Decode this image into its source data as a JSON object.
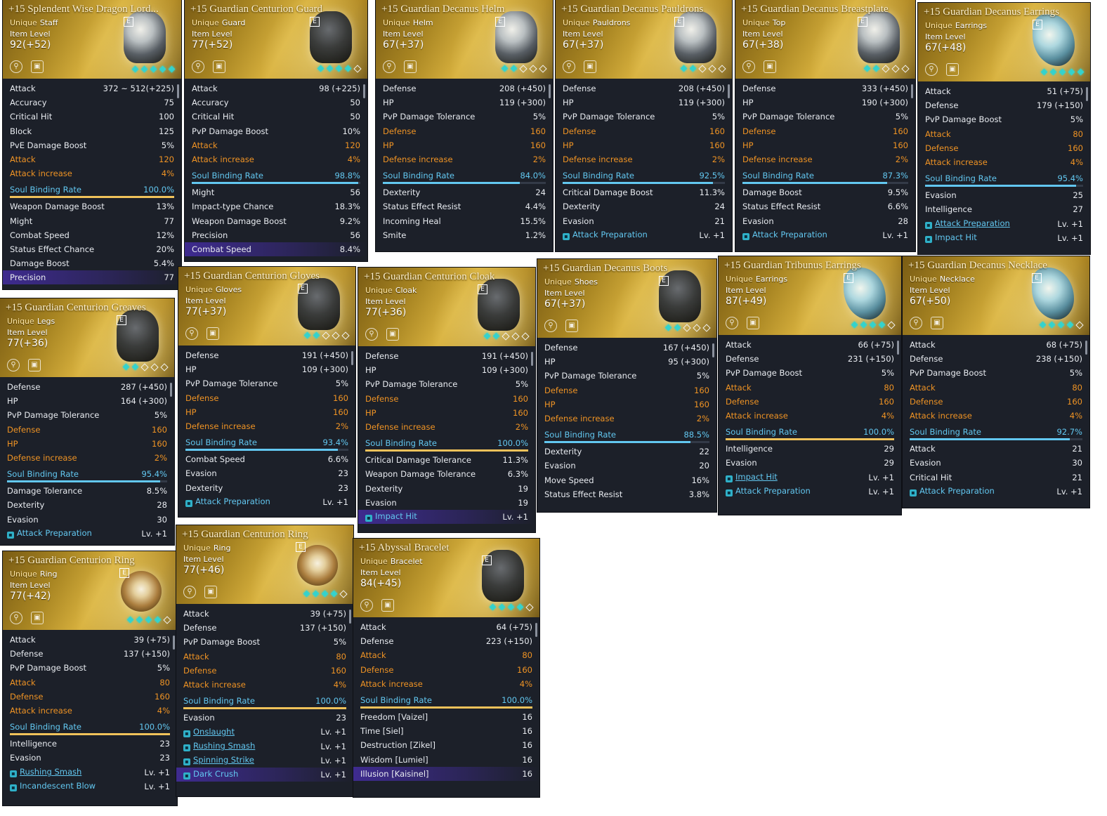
{
  "labels": {
    "item_level": "Item Level",
    "soul_binding_rate": "Soul Binding Rate",
    "badge": "E"
  },
  "items": [
    {
      "name": "+15 Splendent Wise Dragon Lord...",
      "rarity": "Unique",
      "type": "Staff",
      "level": "92(+52)",
      "art": "staff-art",
      "enhance": [
        true,
        true,
        true,
        true,
        true
      ],
      "base": [
        [
          "Attack",
          "372 ~ 512(+225)"
        ],
        [
          "Accuracy",
          "75"
        ],
        [
          "Critical Hit",
          "100"
        ],
        [
          "Block",
          "125"
        ],
        [
          "PvE Damage Boost",
          "5%"
        ]
      ],
      "bonus": [
        [
          "Attack",
          "120"
        ],
        [
          "Attack increase",
          "4%"
        ]
      ],
      "soul_rate": "100.0%",
      "soul_pct": 100,
      "soul": [
        [
          "Weapon Damage Boost",
          "13%"
        ],
        [
          "Might",
          "77"
        ],
        [
          "Combat Speed",
          "12%"
        ],
        [
          "Status Effect Chance",
          "20%"
        ],
        [
          "Damage Boost",
          "5.4%"
        ],
        [
          "Precision",
          "77"
        ]
      ],
      "highlight": 5
    },
    {
      "name": "+15 Guardian Centurion Guard",
      "rarity": "Unique",
      "type": "Guard",
      "level": "77(+52)",
      "art": "guard-art",
      "enhance": [
        true,
        true,
        true,
        true,
        false
      ],
      "base": [
        [
          "Attack",
          "98 (+225)"
        ],
        [
          "Accuracy",
          "50"
        ],
        [
          "Critical Hit",
          "50"
        ],
        [
          "PvP Damage Boost",
          "10%"
        ]
      ],
      "bonus": [
        [
          "Attack",
          "120"
        ],
        [
          "Attack increase",
          "4%"
        ]
      ],
      "soul_rate": "98.8%",
      "soul_pct": 98.8,
      "soul": [
        [
          "Might",
          "56"
        ],
        [
          "Impact-type Chance",
          "18.3%"
        ],
        [
          "Weapon Damage Boost",
          "9.2%"
        ],
        [
          "Precision",
          "56"
        ],
        [
          "Combat Speed",
          "8.4%"
        ]
      ],
      "highlight": 4
    },
    {
      "name": "+15 Guardian Decanus Helm",
      "rarity": "Unique",
      "type": "Helm",
      "level": "67(+37)",
      "art": "helm-art",
      "enhance": [
        true,
        true,
        false,
        false,
        false
      ],
      "base": [
        [
          "Defense",
          "208 (+450)"
        ],
        [
          "HP",
          "119 (+300)"
        ],
        [
          "PvP Damage Tolerance",
          "5%"
        ]
      ],
      "bonus": [
        [
          "Defense",
          "160"
        ],
        [
          "HP",
          "160"
        ],
        [
          "Defense increase",
          "2%"
        ]
      ],
      "soul_rate": "84.0%",
      "soul_pct": 84,
      "soul": [
        [
          "Dexterity",
          "24"
        ],
        [
          "Status Effect Resist",
          "4.4%"
        ],
        [
          "Incoming Heal",
          "15.5%"
        ],
        [
          "Smite",
          "1.2%"
        ]
      ]
    },
    {
      "name": "+15 Guardian Decanus Pauldrons",
      "rarity": "Unique",
      "type": "Pauldrons",
      "level": "67(+37)",
      "art": "pauldrons-art",
      "enhance": [
        true,
        true,
        false,
        false,
        false
      ],
      "base": [
        [
          "Defense",
          "208 (+450)"
        ],
        [
          "HP",
          "119 (+300)"
        ],
        [
          "PvP Damage Tolerance",
          "5%"
        ]
      ],
      "bonus": [
        [
          "Defense",
          "160"
        ],
        [
          "HP",
          "160"
        ],
        [
          "Defense increase",
          "2%"
        ]
      ],
      "soul_rate": "92.5%",
      "soul_pct": 92.5,
      "soul": [
        [
          "Critical Damage Boost",
          "11.3%"
        ],
        [
          "Dexterity",
          "24"
        ],
        [
          "Evasion",
          "21"
        ]
      ],
      "skills": [
        [
          "Attack Preparation",
          "Lv. +1",
          false
        ]
      ]
    },
    {
      "name": "+15 Guardian Decanus Breastplate",
      "rarity": "Unique",
      "type": "Top",
      "level": "67(+38)",
      "art": "breastplate-art",
      "enhance": [
        true,
        true,
        false,
        false,
        false
      ],
      "base": [
        [
          "Defense",
          "333 (+450)"
        ],
        [
          "HP",
          "190 (+300)"
        ],
        [
          "PvP Damage Tolerance",
          "5%"
        ]
      ],
      "bonus": [
        [
          "Defense",
          "160"
        ],
        [
          "HP",
          "160"
        ],
        [
          "Defense increase",
          "2%"
        ]
      ],
      "soul_rate": "87.3%",
      "soul_pct": 87.3,
      "soul": [
        [
          "Damage Boost",
          "9.5%"
        ],
        [
          "Status Effect Resist",
          "6.6%"
        ],
        [
          "Evasion",
          "28"
        ]
      ],
      "skills": [
        [
          "Attack Preparation",
          "Lv. +1",
          false
        ]
      ]
    },
    {
      "name": "+15 Guardian Decanus Earrings",
      "rarity": "Unique",
      "type": "Earrings",
      "level": "67(+48)",
      "art": "earrings-art",
      "enhance": [
        true,
        true,
        true,
        true,
        true
      ],
      "base": [
        [
          "Attack",
          "51 (+75)"
        ],
        [
          "Defense",
          "179 (+150)"
        ],
        [
          "PvP Damage Boost",
          "5%"
        ]
      ],
      "bonus": [
        [
          "Attack",
          "80"
        ],
        [
          "Defense",
          "160"
        ],
        [
          "Attack increase",
          "4%"
        ]
      ],
      "soul_rate": "95.4%",
      "soul_pct": 95.4,
      "soul": [
        [
          "Evasion",
          "25"
        ],
        [
          "Intelligence",
          "27"
        ]
      ],
      "skills": [
        [
          "Attack Preparation",
          "Lv. +1",
          true
        ],
        [
          "Impact Hit",
          "Lv. +1",
          false
        ]
      ]
    },
    {
      "name": "+15 Guardian Centurion Greaves",
      "rarity": "Unique",
      "type": "Legs",
      "level": "77(+36)",
      "art": "greaves-art",
      "enhance": [
        true,
        true,
        false,
        false,
        false
      ],
      "base": [
        [
          "Defense",
          "287 (+450)"
        ],
        [
          "HP",
          "164 (+300)"
        ],
        [
          "PvP Damage Tolerance",
          "5%"
        ]
      ],
      "bonus": [
        [
          "Defense",
          "160"
        ],
        [
          "HP",
          "160"
        ],
        [
          "Defense increase",
          "2%"
        ]
      ],
      "soul_rate": "95.4%",
      "soul_pct": 95.4,
      "soul": [
        [
          "Damage Tolerance",
          "8.5%"
        ],
        [
          "Dexterity",
          "28"
        ],
        [
          "Evasion",
          "30"
        ]
      ],
      "skills": [
        [
          "Attack Preparation",
          "Lv. +1",
          false
        ]
      ]
    },
    {
      "name": "+15 Guardian Centurion Gloves",
      "rarity": "Unique",
      "type": "Gloves",
      "level": "77(+37)",
      "art": "gloves-art",
      "enhance": [
        true,
        true,
        false,
        false,
        false
      ],
      "base": [
        [
          "Defense",
          "191 (+450)"
        ],
        [
          "HP",
          "109 (+300)"
        ],
        [
          "PvP Damage Tolerance",
          "5%"
        ]
      ],
      "bonus": [
        [
          "Defense",
          "160"
        ],
        [
          "HP",
          "160"
        ],
        [
          "Defense increase",
          "2%"
        ]
      ],
      "soul_rate": "93.4%",
      "soul_pct": 93.4,
      "soul": [
        [
          "Combat Speed",
          "6.6%"
        ],
        [
          "Evasion",
          "23"
        ],
        [
          "Dexterity",
          "23"
        ]
      ],
      "skills": [
        [
          "Attack Preparation",
          "Lv. +1",
          false
        ]
      ]
    },
    {
      "name": "+15 Guardian Centurion Cloak",
      "rarity": "Unique",
      "type": "Cloak",
      "level": "77(+36)",
      "art": "cloak-art",
      "enhance": [
        true,
        true,
        false,
        false,
        false
      ],
      "base": [
        [
          "Defense",
          "191 (+450)"
        ],
        [
          "HP",
          "109 (+300)"
        ],
        [
          "PvP Damage Tolerance",
          "5%"
        ]
      ],
      "bonus": [
        [
          "Defense",
          "160"
        ],
        [
          "HP",
          "160"
        ],
        [
          "Defense increase",
          "2%"
        ]
      ],
      "soul_rate": "100.0%",
      "soul_pct": 100,
      "soul": [
        [
          "Critical Damage Tolerance",
          "11.3%"
        ],
        [
          "Weapon Damage Tolerance",
          "6.3%"
        ],
        [
          "Dexterity",
          "19"
        ],
        [
          "Evasion",
          "19"
        ]
      ],
      "skills": [
        [
          "Impact Hit",
          "Lv. +1",
          false
        ]
      ],
      "highlight_skill": 0
    },
    {
      "name": "+15 Guardian Decanus Boots",
      "rarity": "Unique",
      "type": "Shoes",
      "level": "67(+37)",
      "art": "boots-art",
      "enhance": [
        true,
        true,
        false,
        false,
        false
      ],
      "base": [
        [
          "Defense",
          "167 (+450)"
        ],
        [
          "HP",
          "95 (+300)"
        ],
        [
          "PvP Damage Tolerance",
          "5%"
        ]
      ],
      "bonus": [
        [
          "Defense",
          "160"
        ],
        [
          "HP",
          "160"
        ],
        [
          "Defense increase",
          "2%"
        ]
      ],
      "soul_rate": "88.5%",
      "soul_pct": 88.5,
      "soul": [
        [
          "Dexterity",
          "22"
        ],
        [
          "Evasion",
          "20"
        ],
        [
          "Move Speed",
          "16%"
        ],
        [
          "Status Effect Resist",
          "3.8%"
        ]
      ]
    },
    {
      "name": "+15 Guardian Tribunus Earrings",
      "rarity": "Unique",
      "type": "Earrings",
      "level": "87(+49)",
      "art": "tribunus-earrings-art",
      "enhance": [
        true,
        true,
        true,
        true,
        false
      ],
      "base": [
        [
          "Attack",
          "66 (+75)"
        ],
        [
          "Defense",
          "231 (+150)"
        ],
        [
          "PvP Damage Boost",
          "5%"
        ]
      ],
      "bonus": [
        [
          "Attack",
          "80"
        ],
        [
          "Defense",
          "160"
        ],
        [
          "Attack increase",
          "4%"
        ]
      ],
      "soul_rate": "100.0%",
      "soul_pct": 100,
      "soul": [
        [
          "Intelligence",
          "29"
        ],
        [
          "Evasion",
          "29"
        ]
      ],
      "skills": [
        [
          "Impact Hit",
          "Lv. +1",
          true
        ],
        [
          "Attack Preparation",
          "Lv. +1",
          false
        ]
      ]
    },
    {
      "name": "+15 Guardian Decanus Necklace",
      "rarity": "Unique",
      "type": "Necklace",
      "level": "67(+50)",
      "art": "necklace-art",
      "enhance": [
        true,
        true,
        true,
        true,
        false
      ],
      "base": [
        [
          "Attack",
          "68 (+75)"
        ],
        [
          "Defense",
          "238 (+150)"
        ],
        [
          "PvP Damage Boost",
          "5%"
        ]
      ],
      "bonus": [
        [
          "Attack",
          "80"
        ],
        [
          "Defense",
          "160"
        ],
        [
          "Attack increase",
          "4%"
        ]
      ],
      "soul_rate": "92.7%",
      "soul_pct": 92.7,
      "soul": [
        [
          "Attack",
          "21"
        ],
        [
          "Evasion",
          "30"
        ],
        [
          "Critical Hit",
          "21"
        ]
      ],
      "skills": [
        [
          "Attack Preparation",
          "Lv. +1",
          false
        ]
      ]
    },
    {
      "name": "+15 Guardian Centurion Ring",
      "rarity": "Unique",
      "type": "Ring",
      "level": "77(+42)",
      "art": "ring-art",
      "enhance": [
        true,
        true,
        true,
        true,
        false
      ],
      "base": [
        [
          "Attack",
          "39 (+75)"
        ],
        [
          "Defense",
          "137 (+150)"
        ],
        [
          "PvP Damage Boost",
          "5%"
        ]
      ],
      "bonus": [
        [
          "Attack",
          "80"
        ],
        [
          "Defense",
          "160"
        ],
        [
          "Attack increase",
          "4%"
        ]
      ],
      "soul_rate": "100.0%",
      "soul_pct": 100,
      "soul": [
        [
          "Intelligence",
          "23"
        ],
        [
          "Evasion",
          "23"
        ]
      ],
      "skills": [
        [
          "Rushing Smash",
          "Lv. +1",
          true
        ],
        [
          "Incandescent Blow",
          "Lv. +1",
          false
        ]
      ]
    },
    {
      "name": "+15 Guardian Centurion Ring",
      "rarity": "Unique",
      "type": "Ring",
      "level": "77(+46)",
      "art": "ring-art",
      "enhance": [
        true,
        true,
        true,
        true,
        false
      ],
      "base": [
        [
          "Attack",
          "39 (+75)"
        ],
        [
          "Defense",
          "137 (+150)"
        ],
        [
          "PvP Damage Boost",
          "5%"
        ]
      ],
      "bonus": [
        [
          "Attack",
          "80"
        ],
        [
          "Defense",
          "160"
        ],
        [
          "Attack increase",
          "4%"
        ]
      ],
      "soul_rate": "100.0%",
      "soul_pct": 100,
      "soul": [
        [
          "Evasion",
          "23"
        ]
      ],
      "skills": [
        [
          "Onslaught",
          "Lv. +1",
          true
        ],
        [
          "Rushing Smash",
          "Lv. +1",
          true
        ],
        [
          "Spinning Strike",
          "Lv. +1",
          true
        ],
        [
          "Dark Crush",
          "Lv. +1",
          false
        ]
      ],
      "highlight_skill": 3
    },
    {
      "name": "+15 Abyssal Bracelet",
      "rarity": "Unique",
      "type": "Bracelet",
      "level": "84(+45)",
      "art": "bracelet-art",
      "enhance": [
        true,
        true,
        true,
        true,
        false
      ],
      "base": [
        [
          "Attack",
          "64 (+75)"
        ],
        [
          "Defense",
          "223 (+150)"
        ]
      ],
      "bonus": [
        [
          "Attack",
          "80"
        ],
        [
          "Defense",
          "160"
        ],
        [
          "Attack increase",
          "4%"
        ]
      ],
      "soul_rate": "100.0%",
      "soul_pct": 100,
      "soul": [
        [
          "Freedom [Vaizel]",
          "16"
        ],
        [
          "Time [Siel]",
          "16"
        ],
        [
          "Destruction [Zikel]",
          "16"
        ],
        [
          "Wisdom [Lumiel]",
          "16"
        ],
        [
          "Illusion [Kaisinel]",
          "16"
        ]
      ],
      "highlight": 4
    }
  ]
}
